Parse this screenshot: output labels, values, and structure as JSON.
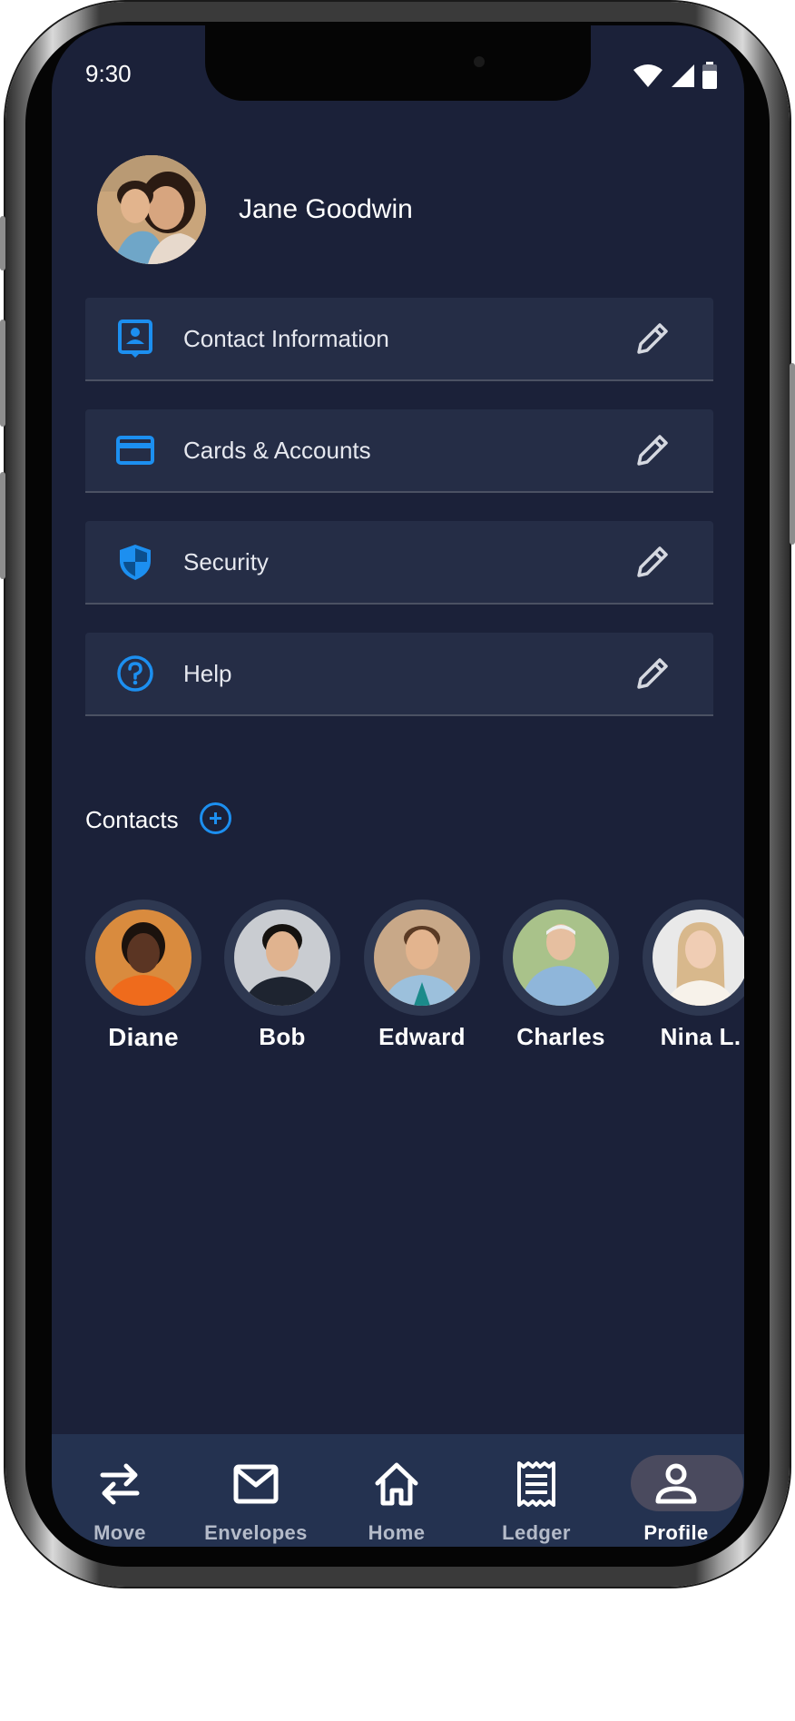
{
  "status_bar": {
    "time": "9:30"
  },
  "profile": {
    "name": "Jane Goodwin",
    "avatar_icon": "family-photo"
  },
  "menu": [
    {
      "label": "Contact Information",
      "icon": "contact-card-icon",
      "action_icon": "pencil-icon"
    },
    {
      "label": "Cards & Accounts",
      "icon": "credit-card-icon",
      "action_icon": "pencil-icon"
    },
    {
      "label": "Security",
      "icon": "shield-icon",
      "action_icon": "pencil-icon"
    },
    {
      "label": "Help",
      "icon": "help-circle-icon",
      "action_icon": "pencil-icon"
    }
  ],
  "contacts": {
    "label": "Contacts",
    "add_icon": "plus-circle-icon",
    "items": [
      {
        "name": "Diane"
      },
      {
        "name": "Bob"
      },
      {
        "name": "Edward"
      },
      {
        "name": "Charles"
      },
      {
        "name": "Nina L."
      }
    ]
  },
  "nav": {
    "items": [
      {
        "label": "Move",
        "icon": "swap-arrows-icon"
      },
      {
        "label": "Envelopes",
        "icon": "envelope-icon"
      },
      {
        "label": "Home",
        "icon": "home-icon"
      },
      {
        "label": "Ledger",
        "icon": "receipt-icon"
      },
      {
        "label": "Profile",
        "icon": "person-icon",
        "active": true
      }
    ]
  },
  "colors": {
    "background": "#1b2139",
    "card": "#252d46",
    "accent": "#1c8ff0",
    "nav_bg": "#243250",
    "nav_active_pill": "#4a4a5e"
  }
}
